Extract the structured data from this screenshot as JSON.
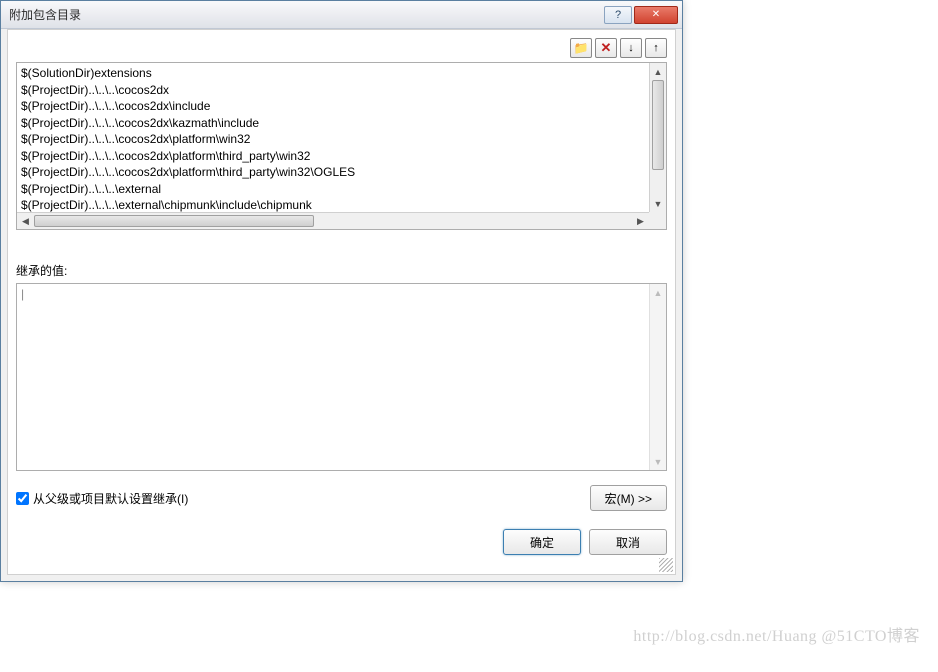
{
  "window": {
    "title": "附加包含目录"
  },
  "toolbar": {
    "new_folder_tip": "新建行",
    "delete_tip": "删除",
    "move_down_tip": "下移",
    "move_up_tip": "上移"
  },
  "list": {
    "items": [
      "$(SolutionDir)extensions",
      "$(ProjectDir)..\\..\\..\\cocos2dx",
      "$(ProjectDir)..\\..\\..\\cocos2dx\\include",
      "$(ProjectDir)..\\..\\..\\cocos2dx\\kazmath\\include",
      "$(ProjectDir)..\\..\\..\\cocos2dx\\platform\\win32",
      "$(ProjectDir)..\\..\\..\\cocos2dx\\platform\\third_party\\win32",
      "$(ProjectDir)..\\..\\..\\cocos2dx\\platform\\third_party\\win32\\OGLES",
      "$(ProjectDir)..\\..\\..\\external",
      "$(ProjectDir)..\\..\\..\\external\\chipmunk\\include\\chipmunk"
    ]
  },
  "inherited": {
    "label": "继承的值:",
    "cursor": "|"
  },
  "checkbox": {
    "label": "从父级或项目默认设置继承(I)",
    "checked": true
  },
  "buttons": {
    "macros": "宏(M) >>",
    "ok": "确定",
    "cancel": "取消"
  },
  "watermark": "http://blog.csdn.net/Huang @51CTO博客"
}
